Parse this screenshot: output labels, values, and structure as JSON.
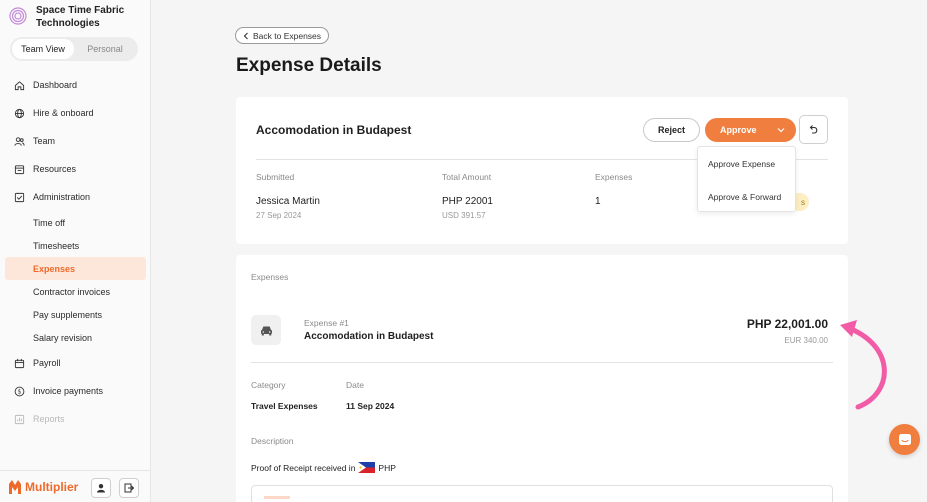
{
  "sidebar": {
    "org_name": "Space Time Fabric Technologies",
    "view_toggle": {
      "team": "Team View",
      "personal": "Personal"
    },
    "items": [
      {
        "label": "Dashboard",
        "icon": "home-icon"
      },
      {
        "label": "Hire & onboard",
        "icon": "globe-icon"
      },
      {
        "label": "Team",
        "icon": "people-icon"
      },
      {
        "label": "Resources",
        "icon": "folder-icon"
      },
      {
        "label": "Administration",
        "icon": "checkbox-icon"
      }
    ],
    "sub_items": [
      {
        "label": "Time off"
      },
      {
        "label": "Timesheets"
      },
      {
        "label": "Expenses"
      },
      {
        "label": "Contractor invoices"
      },
      {
        "label": "Pay supplements"
      },
      {
        "label": "Salary revision"
      }
    ],
    "bottom_items": [
      {
        "label": "Payroll",
        "icon": "calendar-icon"
      },
      {
        "label": "Invoice payments",
        "icon": "dollar-circle-icon"
      },
      {
        "label": "Reports",
        "icon": "report-icon"
      }
    ],
    "brand": "Multiplier"
  },
  "header": {
    "back_label": "Back to Expenses",
    "title": "Expense Details"
  },
  "summary": {
    "title": "Accomodation in Budapest",
    "reject_label": "Reject",
    "approve_label": "Approve",
    "submitted_label": "Submitted",
    "submitted_name": "Jessica Martin",
    "submitted_date": "27 Sep 2024",
    "total_label": "Total Amount",
    "total_amount": "PHP 22001",
    "total_usd": "USD 391.57",
    "expenses_label": "Expenses",
    "expenses_count": "1",
    "status_partial": "s"
  },
  "dropdown": {
    "options": [
      "Approve Expense",
      "Approve & Forward"
    ]
  },
  "expense": {
    "section_label": "Expenses",
    "number": "Expense #1",
    "name": "Accomodation in Budapest",
    "amount": "PHP 22,001.00",
    "converted": "EUR 340.00",
    "category_label": "Category",
    "category": "Travel Expenses",
    "date_label": "Date",
    "date": "11 Sep 2024",
    "description_label": "Description",
    "description": "Proof of Receipt received in",
    "currency": "PHP"
  },
  "colors": {
    "accent": "#f07e3f",
    "annotation": "#f25ba5",
    "active_bg": "#fde7da"
  }
}
